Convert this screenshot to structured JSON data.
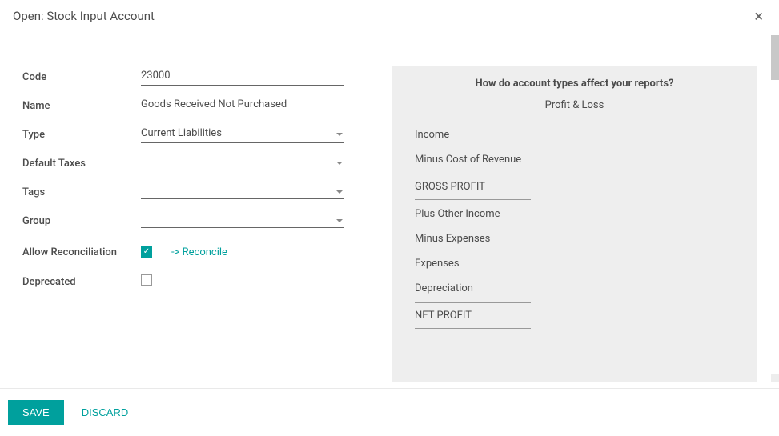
{
  "header": {
    "title": "Open: Stock Input Account",
    "close_label": "×"
  },
  "form": {
    "labels": {
      "code": "Code",
      "name": "Name",
      "type": "Type",
      "default_taxes": "Default Taxes",
      "tags": "Tags",
      "group": "Group",
      "allow_reconciliation": "Allow Reconciliation",
      "deprecated": "Deprecated"
    },
    "values": {
      "code": "23000",
      "name": "Goods Received Not Purchased",
      "type": "Current Liabilities"
    },
    "reconcile_link": "-> Reconcile",
    "allow_reconciliation_checked": true,
    "deprecated_checked": false
  },
  "info": {
    "title": "How do account types affect your reports?",
    "subtitle": "Profit & Loss",
    "items": {
      "income": "Income",
      "minus_cost": "Minus Cost of Revenue",
      "gross_profit": "GROSS PROFIT",
      "plus_other": "Plus Other Income",
      "minus_expenses": "Minus Expenses",
      "expenses": "Expenses",
      "depreciation": "Depreciation",
      "net_profit": "NET PROFIT"
    }
  },
  "footer": {
    "save": "Save",
    "discard": "Discard"
  }
}
